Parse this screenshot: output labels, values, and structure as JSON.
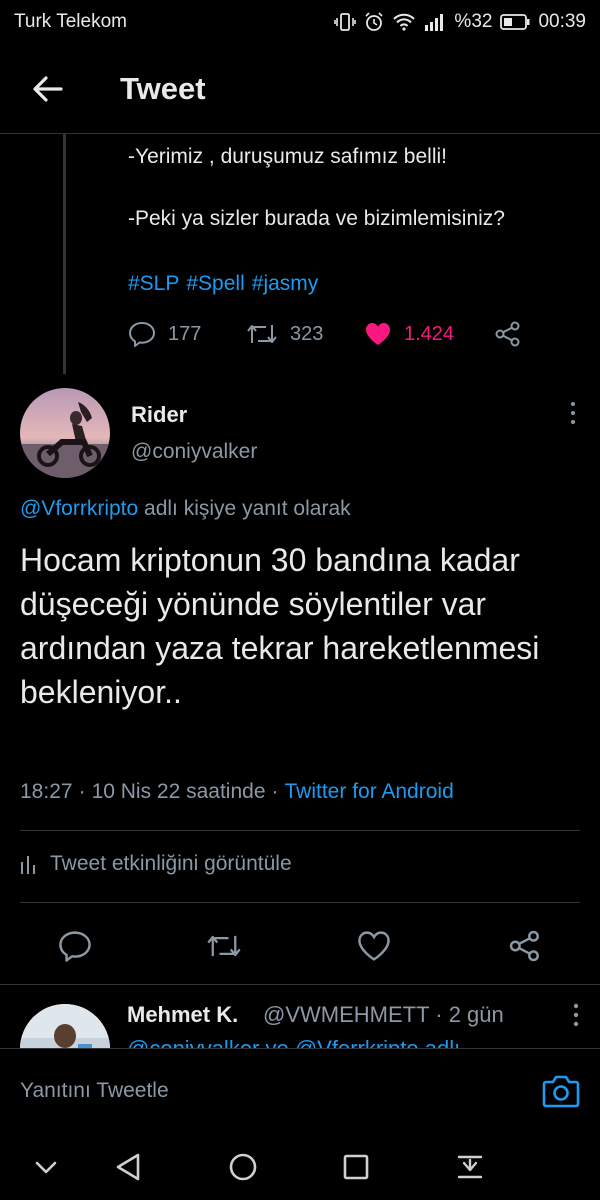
{
  "status_bar": {
    "carrier": "Turk Telekom",
    "battery": "%32",
    "time": "00:39"
  },
  "header": {
    "title": "Tweet"
  },
  "parent_tweet": {
    "line1": "-Yerimiz , duruşumuz safımız belli!",
    "line2": "-Peki ya sizler burada ve bizimlemisiniz?",
    "hashtags": [
      "#SLP",
      "#Spell",
      "#jasmy"
    ],
    "replies": "177",
    "retweets": "323",
    "likes": "1.424",
    "liked": true
  },
  "focused_tweet": {
    "author_name": "Rider",
    "author_handle": "@coniyvalker",
    "reply_to_mention": "@Vforrkripto",
    "reply_to_suffix": "adlı kişiye yanıt olarak",
    "text": "Hocam kriptonun 30 bandına kadar düşeceği yönünde söylentiler var ardından yaza tekrar hareketlenmesi bekleniyor..",
    "time": "18:27",
    "date": "10 Nis 22 saatinde",
    "source": "Twitter for Android",
    "activity_label": "Tweet etkinliğini görüntüle"
  },
  "reply": {
    "author_name": "Mehmet K.",
    "author_handle": "@VWMEHMETT",
    "age": "· 2 gün",
    "partial_text": "@coniyvalker ve @Vforrkripto adlı"
  },
  "composer": {
    "placeholder": "Yanıtını Tweetle"
  },
  "colors": {
    "background": "#000000",
    "text": "#e7e9ea",
    "muted": "#8b98a5",
    "link": "#1d9bf0",
    "like": "#f91880",
    "border": "#2f3336"
  }
}
